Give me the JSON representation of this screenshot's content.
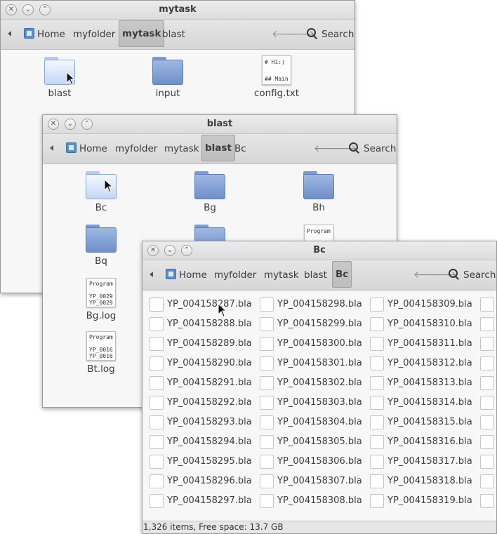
{
  "windows": {
    "mytask": {
      "title": "mytask",
      "breadcrumbs": [
        "Home",
        "myfolder",
        "mytask",
        "blast"
      ],
      "active_crumb": "mytask",
      "search_label": "Search",
      "items": [
        {
          "label": "blast",
          "type": "folder"
        },
        {
          "label": "input",
          "type": "folder"
        },
        {
          "label": "config.txt",
          "type": "text",
          "preview": "# Hi:)\n\n## Main"
        }
      ]
    },
    "blast": {
      "title": "blast",
      "breadcrumbs": [
        "Home",
        "myfolder",
        "mytask",
        "blast",
        "Bc"
      ],
      "active_crumb": "blast",
      "search_label": "Search",
      "items": [
        {
          "label": "Bc",
          "type": "folder"
        },
        {
          "label": "Bg",
          "type": "folder"
        },
        {
          "label": "Bh",
          "type": "folder"
        },
        {
          "label": "Bq",
          "type": "folder"
        },
        {
          "label": "",
          "type": "folder"
        },
        {
          "label": "",
          "type": "text",
          "preview": "Program"
        },
        {
          "label": "Bg.log",
          "type": "text",
          "preview": "Program\n\nYP_0029\nYP_0029"
        },
        {
          "label": "Bt.log",
          "type": "text",
          "preview": "Program\n\nYP_0016\nYP_0016"
        }
      ]
    },
    "bc": {
      "title": "Bc",
      "breadcrumbs": [
        "Home",
        "myfolder",
        "mytask",
        "blast",
        "Bc"
      ],
      "active_crumb": "Bc",
      "search_label": "Search",
      "columns": [
        [
          "YP_004158287.bla",
          "YP_004158288.bla",
          "YP_004158289.bla",
          "YP_004158290.bla",
          "YP_004158291.bla",
          "YP_004158292.bla",
          "YP_004158293.bla",
          "YP_004158294.bla",
          "YP_004158295.bla",
          "YP_004158296.bla",
          "YP_004158297.bla"
        ],
        [
          "YP_004158298.bla",
          "YP_004158299.bla",
          "YP_004158300.bla",
          "YP_004158301.bla",
          "YP_004158302.bla",
          "YP_004158303.bla",
          "YP_004158304.bla",
          "YP_004158305.bla",
          "YP_004158306.bla",
          "YP_004158307.bla",
          "YP_004158308.bla"
        ],
        [
          "YP_004158309.bla",
          "YP_004158310.bla",
          "YP_004158311.bla",
          "YP_004158312.bla",
          "YP_004158313.bla",
          "YP_004158314.bla",
          "YP_004158315.bla",
          "YP_004158316.bla",
          "YP_004158317.bla",
          "YP_004158318.bla",
          "YP_004158319.bla"
        ]
      ],
      "status": "1,326 items, Free space: 13.7 GB"
    }
  }
}
